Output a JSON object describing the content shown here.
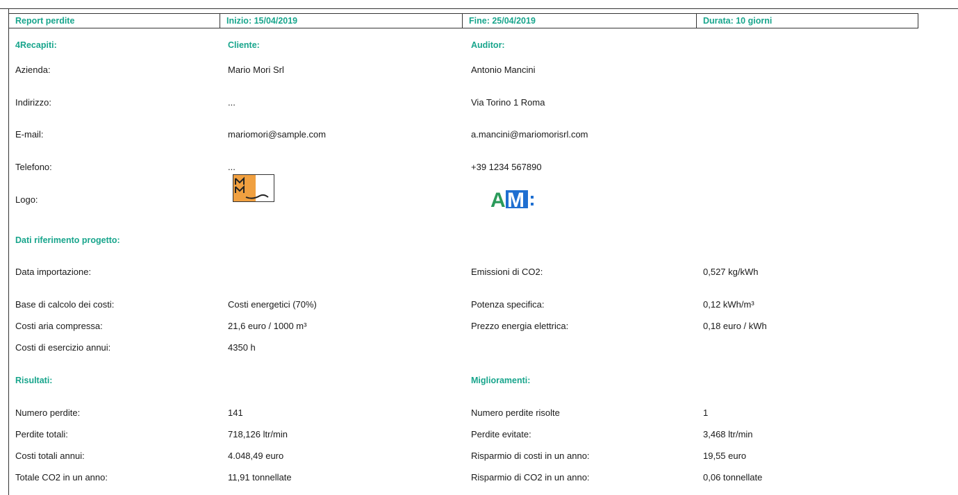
{
  "header": {
    "title": "Report perdite",
    "start": "Inizio: 15/04/2019",
    "end": "Fine: 25/04/2019",
    "duration": "Durata: 10 giorni"
  },
  "contacts": {
    "heading": "4Recapiti:",
    "client_heading": "Cliente:",
    "auditor_heading": "Auditor:",
    "rows": [
      {
        "label": "Azienda:",
        "client": "Mario Mori Srl",
        "auditor": "Antonio Mancini"
      },
      {
        "label": "Indirizzo:",
        "client": "...",
        "auditor": "Via Torino 1 Roma"
      },
      {
        "label": "E-mail:",
        "client": "mariomori@sample.com",
        "auditor": "a.mancini@mariomorisrl.com"
      },
      {
        "label": "Telefono:",
        "client": "...",
        "auditor": "+39 1234 567890"
      }
    ],
    "logo_label": "Logo:",
    "client_logo_text": "MM",
    "auditor_logo_text": "AM"
  },
  "project": {
    "heading": "Dati riferimento progetto:",
    "rows": [
      {
        "l1": "Data importazione:",
        "v1": "",
        "l2": "Emissioni di CO2:",
        "v2": "0,527 kg/kWh"
      },
      {
        "l1": "Base di calcolo dei costi:",
        "v1": "Costi energetici (70%)",
        "l2": "Potenza specifica:",
        "v2": "0,12 kWh/m³"
      },
      {
        "l1": "Costi aria compressa:",
        "v1": "21,6 euro / 1000 m³",
        "l2": "Prezzo energia elettrica:",
        "v2": "0,18 euro / kWh"
      },
      {
        "l1": "Costi di esercizio annui:",
        "v1": "4350 h",
        "l2": "",
        "v2": ""
      }
    ]
  },
  "results": {
    "heading": "Risultati:",
    "improvements_heading": "Miglioramenti:",
    "rows": [
      {
        "l1": "Numero perdite:",
        "v1": "141",
        "l2": "Numero perdite risolte",
        "v2": "1"
      },
      {
        "l1": "Perdite totali:",
        "v1": "718,126 ltr/min",
        "l2": "Perdite evitate:",
        "v2": "3,468 ltr/min"
      },
      {
        "l1": "Costi totali annui:",
        "v1": "4.048,49 euro",
        "l2": "Risparmio di costi in un anno:",
        "v2": "19,55 euro"
      },
      {
        "l1": "Totale CO2 in un anno:",
        "v1": "11,91 tonnellate",
        "l2": "Risparmio di CO2 in un anno:",
        "v2": "0,06 tonnellate"
      }
    ]
  },
  "colors": {
    "accent": "#18a58c",
    "client_logo_orange": "#f0a040",
    "auditor_logo_green": "#2a9a5a",
    "auditor_logo_blue": "#1f6fd1"
  }
}
